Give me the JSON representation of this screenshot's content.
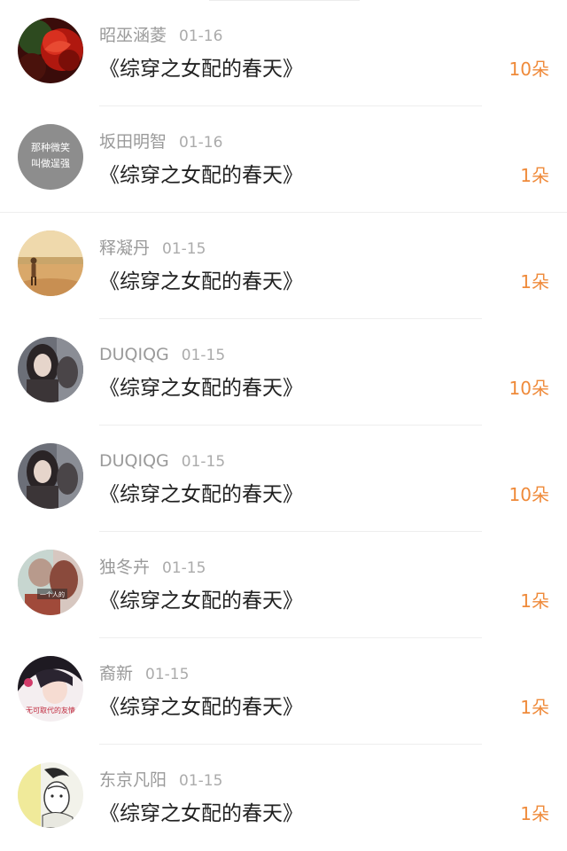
{
  "gift_list": {
    "items": [
      {
        "name": "昭巫涵菱",
        "date": "01-16",
        "book": "《综穿之女配的春天》",
        "count": "10朵",
        "avatar_icon": "red-flower-avatar-icon"
      },
      {
        "name": "坂田明智",
        "date": "01-16",
        "book": "《综穿之女配的春天》",
        "count": "1朵",
        "avatar_icon": "text-avatar-icon",
        "avatar_text": [
          "那种微笑",
          "叫做逞强"
        ]
      },
      {
        "name": "释凝丹",
        "date": "01-15",
        "book": "《综穿之女配的春天》",
        "count": "1朵",
        "avatar_icon": "desert-walker-avatar-icon"
      },
      {
        "name": "DUQIQG",
        "date": "01-15",
        "book": "《综穿之女配的春天》",
        "count": "10朵",
        "avatar_icon": "girl-portrait-avatar-icon"
      },
      {
        "name": "DUQIQG",
        "date": "01-15",
        "book": "《综穿之女配的春天》",
        "count": "10朵",
        "avatar_icon": "girl-portrait-avatar-icon"
      },
      {
        "name": "独冬卉",
        "date": "01-15",
        "book": "《综穿之女配的春天》",
        "count": "1朵",
        "avatar_icon": "couple-photo-avatar-icon",
        "avatar_text": [
          "一个人的"
        ]
      },
      {
        "name": "裔新",
        "date": "01-15",
        "book": "《综穿之女配的春天》",
        "count": "1朵",
        "avatar_icon": "anime-girl-avatar-icon",
        "avatar_text": [
          "无可取代的友情"
        ]
      },
      {
        "name": "东京凡阳",
        "date": "01-15",
        "book": "《综穿之女配的春天》",
        "count": "1朵",
        "avatar_icon": "sketch-boy-avatar-icon"
      }
    ]
  },
  "colors": {
    "count": "#ef8a3a",
    "name": "#9a9a9a",
    "book": "#222222"
  }
}
